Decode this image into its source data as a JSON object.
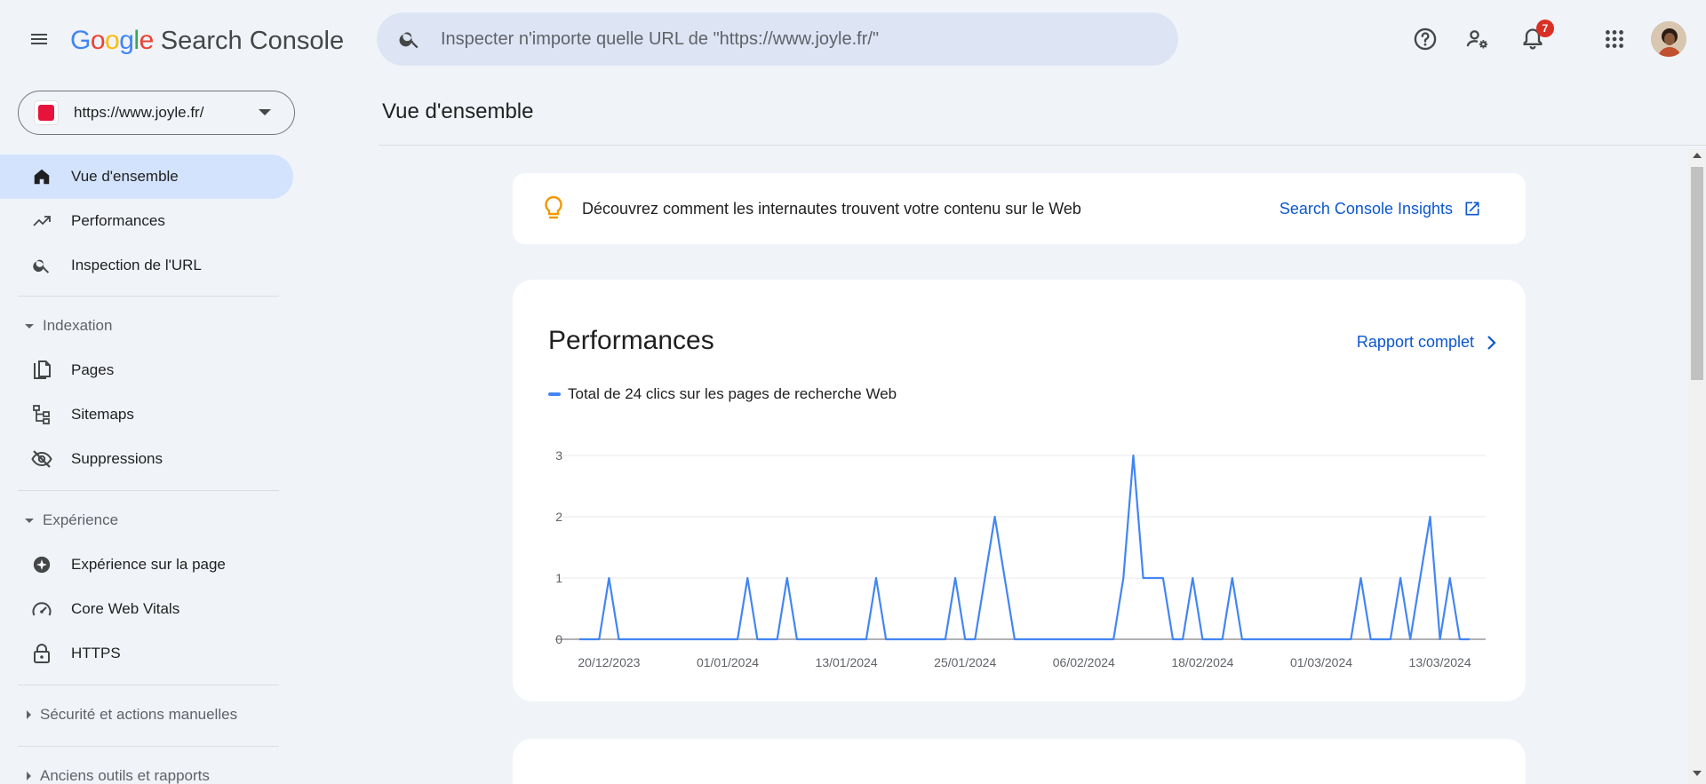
{
  "header": {
    "logo_letters": [
      "G",
      "o",
      "o",
      "g",
      "l",
      "e"
    ],
    "logo_colors": [
      "#4285f4",
      "#ea4335",
      "#fbbc05",
      "#4285f4",
      "#34a853",
      "#ea4335"
    ],
    "product_name": "Search Console",
    "search_placeholder": "Inspecter n'importe quelle URL de \"https://www.joyle.fr/\"",
    "notifications_count": "7"
  },
  "sidebar": {
    "property_url": "https://www.joyle.fr/",
    "items": [
      {
        "label": "Vue d'ensemble",
        "icon": "home-icon",
        "active": true
      },
      {
        "label": "Performances",
        "icon": "trending-up-icon"
      },
      {
        "label": "Inspection de l'URL",
        "icon": "search-icon"
      }
    ],
    "sections": [
      {
        "label": "Indexation",
        "expanded": true,
        "items": [
          {
            "label": "Pages",
            "icon": "pages-icon"
          },
          {
            "label": "Sitemaps",
            "icon": "sitemap-icon"
          },
          {
            "label": "Suppressions",
            "icon": "eye-off-icon"
          }
        ]
      },
      {
        "label": "Expérience",
        "expanded": true,
        "items": [
          {
            "label": "Expérience sur la page",
            "icon": "plus-circle-icon"
          },
          {
            "label": "Core Web Vitals",
            "icon": "gauge-icon"
          },
          {
            "label": "HTTPS",
            "icon": "lock-icon"
          }
        ]
      },
      {
        "label": "Sécurité et actions manuelles",
        "expanded": false
      },
      {
        "label": "Anciens outils et rapports",
        "expanded": false
      }
    ]
  },
  "main": {
    "page_title": "Vue d'ensemble",
    "insights": {
      "message": "Découvrez comment les internautes trouvent votre contenu sur le Web",
      "link_label": "Search Console Insights"
    },
    "performance": {
      "title": "Performances",
      "report_link": "Rapport complet",
      "legend": "Total de 24 clics sur les pages de recherche Web"
    }
  },
  "colors": {
    "accent": "#0b57d0",
    "active_nav": "#d3e3fd",
    "series": "#4285f4",
    "badge": "#d93025"
  },
  "chart_data": {
    "type": "line",
    "start_date": "2023-12-17",
    "x_tick_labels": [
      "20/12/2023",
      "01/01/2024",
      "13/01/2024",
      "25/01/2024",
      "06/02/2024",
      "18/02/2024",
      "01/03/2024",
      "13/03/2024"
    ],
    "y_ticks": [
      0,
      1,
      2,
      3
    ],
    "ylim": [
      0,
      3
    ],
    "series": [
      {
        "values": [
          0,
          0,
          0,
          1,
          0,
          0,
          0,
          0,
          0,
          0,
          0,
          0,
          0,
          0,
          0,
          0,
          0,
          1,
          0,
          0,
          0,
          1,
          0,
          0,
          0,
          0,
          0,
          0,
          0,
          0,
          1,
          0,
          0,
          0,
          0,
          0,
          0,
          0,
          1,
          0,
          0,
          1,
          2,
          1,
          0,
          0,
          0,
          0,
          0,
          0,
          0,
          0,
          0,
          0,
          0,
          1,
          3,
          1,
          1,
          1,
          0,
          0,
          1,
          0,
          0,
          0,
          1,
          0,
          0,
          0,
          0,
          0,
          0,
          0,
          0,
          0,
          0,
          0,
          0,
          1,
          0,
          0,
          0,
          1,
          0,
          1,
          2,
          0,
          1,
          0,
          0
        ]
      }
    ]
  }
}
